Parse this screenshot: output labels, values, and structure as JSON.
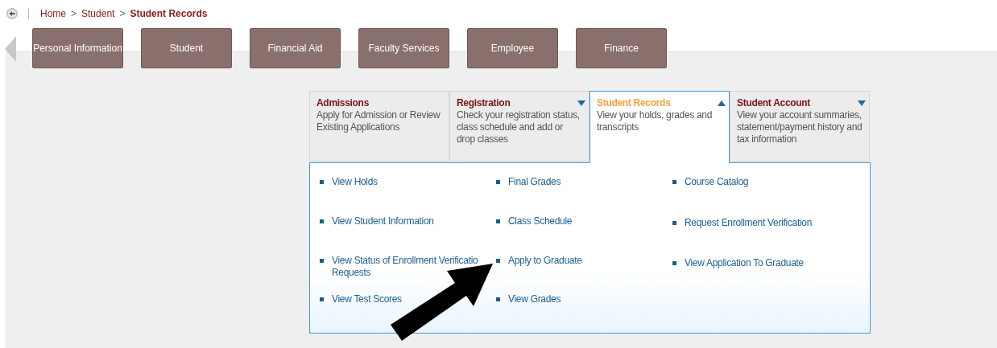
{
  "breadcrumb": [
    {
      "label": "Home",
      "current": false
    },
    {
      "label": "Student",
      "current": false
    },
    {
      "label": "Student Records",
      "current": true
    }
  ],
  "breadcrumb_separator": ">",
  "nav_tabs": [
    {
      "label": "Personal Information"
    },
    {
      "label": "Student"
    },
    {
      "label": "Financial Aid"
    },
    {
      "label": "Faculty Services"
    },
    {
      "label": "Employee"
    },
    {
      "label": "Finance"
    }
  ],
  "menu_cards": [
    {
      "title": "Admissions",
      "description": "Apply for Admission or Review Existing Applications",
      "kind": "link",
      "selected": false
    },
    {
      "title": "Registration",
      "description": "Check your registration status, class schedule and add or drop classes",
      "kind": "dropdown",
      "selected": false
    },
    {
      "title": "Student Records",
      "description": "View your holds, grades and transcripts",
      "kind": "dropdown",
      "selected": true
    },
    {
      "title": "Student Account",
      "description": "View your account summaries, statement/payment history and tax information",
      "kind": "dropdown",
      "selected": false
    }
  ],
  "menu_links": [
    [
      {
        "lines": [
          "View Holds"
        ]
      },
      {
        "lines": [
          "View Student Information"
        ]
      },
      {
        "lines": [
          "View Status of Enrollment Verificatio",
          "Requests"
        ]
      },
      {
        "lines": [
          "View Test Scores"
        ]
      }
    ],
    [
      {
        "lines": [
          "Final Grades"
        ]
      },
      {
        "lines": [
          "Class Schedule"
        ]
      },
      {
        "lines": [
          "Apply to Graduate"
        ]
      },
      {
        "lines": [
          "View Grades"
        ]
      }
    ],
    [
      {
        "lines": [
          "Course Catalog"
        ]
      },
      {
        "lines": [
          "Request Enrollment Verification"
        ]
      },
      {
        "lines": [
          "View Application To Graduate"
        ]
      }
    ]
  ]
}
